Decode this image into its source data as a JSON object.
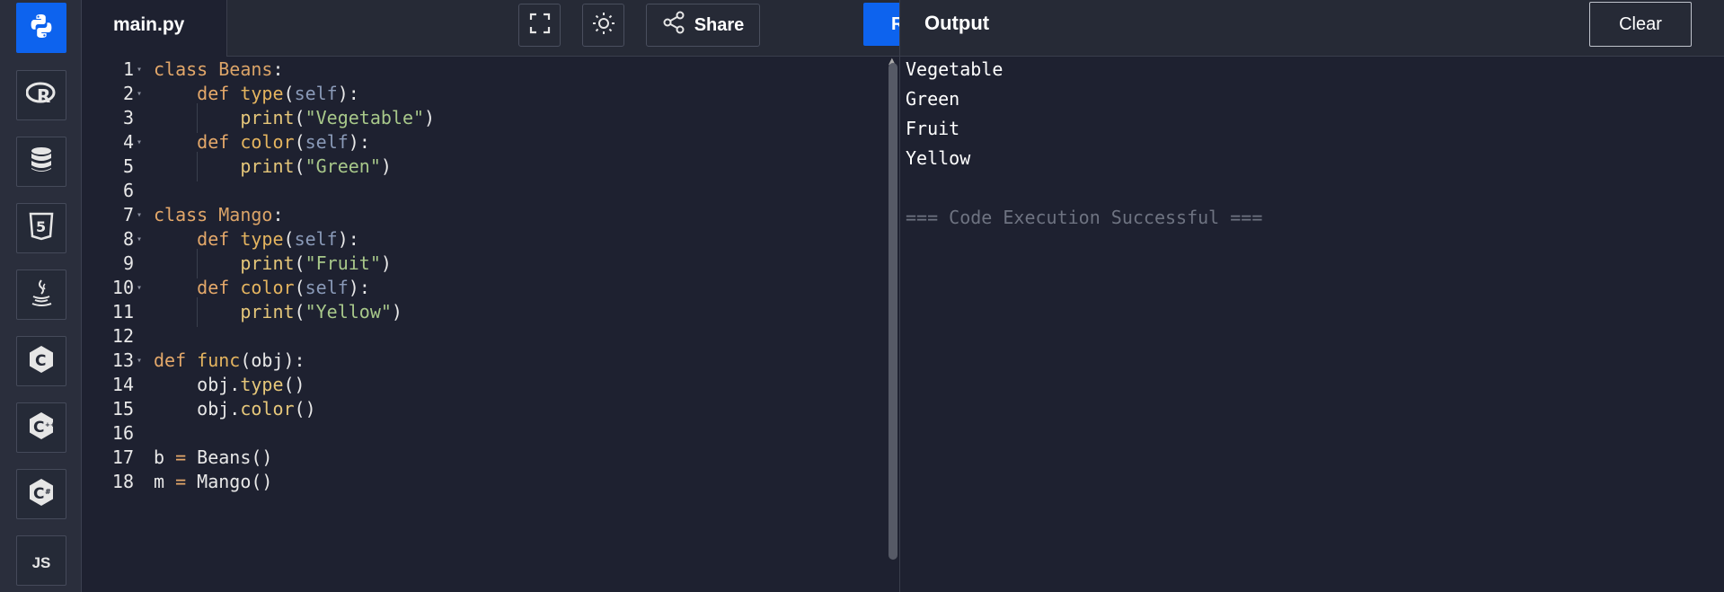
{
  "sidebar": {
    "languages": [
      {
        "icon": "python-icon",
        "active": true
      },
      {
        "icon": "r-icon",
        "text": "R"
      },
      {
        "icon": "database-icon"
      },
      {
        "icon": "html5-icon",
        "text": "5"
      },
      {
        "icon": "java-icon"
      },
      {
        "icon": "c-icon",
        "text": "C"
      },
      {
        "icon": "cpp-icon",
        "text": "C"
      },
      {
        "icon": "csharp-icon",
        "text": "C"
      },
      {
        "icon": "js-icon",
        "text": "JS"
      }
    ]
  },
  "editor": {
    "file_tab": "main.py",
    "toolbar": {
      "fullscreen_icon": "fullscreen-icon",
      "theme_icon": "sun-icon",
      "share_label": "Share",
      "share_icon": "share-icon",
      "run_label": "Run"
    },
    "lines": [
      {
        "n": "1",
        "code": "class Beans:"
      },
      {
        "n": "2",
        "code": "    def type(self):"
      },
      {
        "n": "3",
        "code": "        print(\"Vegetable\")"
      },
      {
        "n": "4",
        "code": "    def color(self):"
      },
      {
        "n": "5",
        "code": "        print(\"Green\")"
      },
      {
        "n": "6",
        "code": ""
      },
      {
        "n": "7",
        "code": "class Mango:"
      },
      {
        "n": "8",
        "code": "    def type(self):"
      },
      {
        "n": "9",
        "code": "        print(\"Fruit\")"
      },
      {
        "n": "10",
        "code": "    def color(self):"
      },
      {
        "n": "11",
        "code": "        print(\"Yellow\")"
      },
      {
        "n": "12",
        "code": ""
      },
      {
        "n": "13",
        "code": "def func(obj):"
      },
      {
        "n": "14",
        "code": "    obj.type()"
      },
      {
        "n": "15",
        "code": "    obj.color()"
      },
      {
        "n": "16",
        "code": ""
      },
      {
        "n": "17",
        "code": "b = Beans()"
      },
      {
        "n": "18",
        "code": "m = Mango()"
      }
    ]
  },
  "output": {
    "title": "Output",
    "clear_label": "Clear",
    "lines": [
      "Vegetable",
      "Green",
      "Fruit",
      "Yellow",
      "",
      "=== Code Execution Successful ==="
    ]
  },
  "colors": {
    "accent": "#0d63ee",
    "background": "#1e2130",
    "panel": "#262a36",
    "keyword": "#e4a86a",
    "string": "#a8c88a",
    "self": "#8a9ab8"
  }
}
